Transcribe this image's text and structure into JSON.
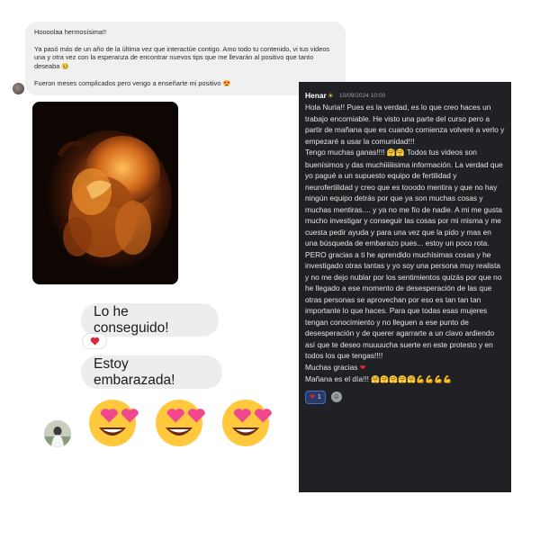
{
  "dm_message": {
    "greeting": "Hoooolaa hermosísima!!",
    "body": "Ya pasó más de un año de la última vez que interactúe contigo. Amo todo tu contenido, vi tus videos una y otra vez con la esperanza de encontrar nuevos tips que me llevarán al positivo que tanto deseaba",
    "closing": "Fueron meses complicados pero vengo a enseñarte mi positivo"
  },
  "chat": {
    "bubble_1": "Lo he conseguido!",
    "bubble_2": "Estoy embarazada!",
    "reaction_icon": "heart-icon",
    "emojis": [
      "smiling-face-heart-eyes-icon",
      "smiling-face-heart-eyes-icon",
      "smiling-face-heart-eyes-icon"
    ]
  },
  "comment": {
    "username": "Henar",
    "timestamp": "10/09/2024 10:00",
    "p1": "Hola Nuria!! Pues es la verdad, es lo que creo haces un trabajo encomiable. He visto una parte del curso pero a partir de mañana que es cuando comienza volveré a verlo y empezaré a usar la comunidad!!!",
    "p2a": "Tengo muchas ganas!!!!",
    "p2b": "Todos tus videos son buenísimos y das muchiiiiiisima información. La verdad que yo pagué a un supuesto equipo de fertilidad y neurofertilidad y creo que es tooodo mentira y que no hay ningún equipo detrás por que ya son muchas cosas y muchas mentiras.... y ya no me fío de nadie. A mi me gusta mucho investigar y conseguir las cosas por mi misma y me cuesta pedir ayuda y para una vez que la pido y mas en una búsqueda de embarazo pues... estoy un poco rota. PERO gracias a ti he aprendido muchísimas cosas y he investigado otras tantas y yo soy una persona muy realista y no me dejo nublar por los sentimientos quizás por que no he llegado a ese momento de desesperación de las que otras personas se aprovechan por eso es tan tan tan importante lo que haces. Para que todas esas mujeres tengan conocimiento y no lleguen a ese punto de desesperación y de querer agarrarte a un clavo ardiendo así que te deseo muuuucha suerte en este protesto y en todos los que tengas!!!!",
    "p3": "Muchas gracias",
    "p4": "Mañana es el día!!!",
    "reaction_count": "1",
    "colors": {
      "panel_bg": "#202124",
      "chip_bg": "#2a3a66",
      "heart": "#e0243a"
    }
  }
}
